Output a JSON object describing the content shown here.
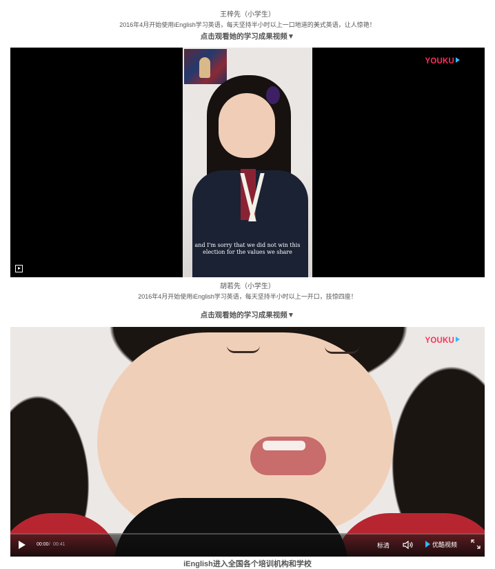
{
  "section1": {
    "name": "王梓先（小学生）",
    "desc": "2016年4月开始使用iEnglish学习英语，每天坚持半小时以上一口地道的美式英语，让人惊艳！",
    "link": "点击观看她的学习成果视频▼"
  },
  "video1": {
    "brand": "YOUKU",
    "subtitle_line1": "and I'm sorry that we did not win this",
    "subtitle_line2": "election for the values we share"
  },
  "section2": {
    "name": "胡若先（小学生）",
    "desc": "2016年4月开始使用iEnglish学习英语，每天坚持半小时以上一开口，技惊四座！",
    "link": "点击观看她的学习成果视频▼"
  },
  "video2": {
    "brand": "YOUKU",
    "time_current": "00:00",
    "time_separator": "/",
    "time_duration": "00:41",
    "quality": "标清",
    "youku_button": "优酷视频",
    "icons": [
      "play-icon",
      "volume-icon",
      "fullscreen-icon"
    ]
  },
  "footer": {
    "title": "iEnglish进入全国各个培训机构和学校"
  },
  "colors": {
    "brand_pink": "#ff2f5c",
    "brand_blue": "#33b7ff",
    "text_gray": "#555555"
  }
}
